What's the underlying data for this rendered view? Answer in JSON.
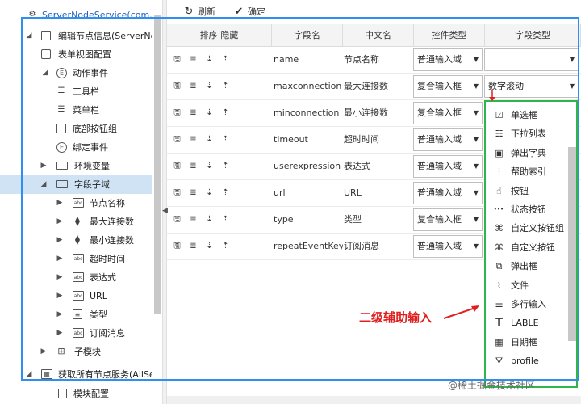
{
  "tree": {
    "items": [
      {
        "label": "ServerNodeService(com.ds.s",
        "icon": "gear-icon"
      },
      {
        "label": "编辑节点信息(ServerNod",
        "icon": "window-icon"
      },
      {
        "label": "表单视图配置",
        "icon": "form-icon"
      },
      {
        "label": "动作事件",
        "icon": "event-icon"
      },
      {
        "label": "工具栏",
        "icon": "toolbar-icon"
      },
      {
        "label": "菜单栏",
        "icon": "menu-icon"
      },
      {
        "label": "底部按钮组",
        "icon": "bottom-bar-icon"
      },
      {
        "label": "绑定事件",
        "icon": "event-icon"
      },
      {
        "label": "环境变量",
        "icon": "env-icon"
      },
      {
        "label": "字段子域",
        "icon": "field-icon"
      },
      {
        "label": "节点名称",
        "icon": "text-field-icon"
      },
      {
        "label": "最大连接数",
        "icon": "spinner-icon"
      },
      {
        "label": "最小连接数",
        "icon": "spinner-icon"
      },
      {
        "label": "超时时间",
        "icon": "text-field-icon"
      },
      {
        "label": "表达式",
        "icon": "text-field-icon"
      },
      {
        "label": "URL",
        "icon": "text-field-icon"
      },
      {
        "label": "类型",
        "icon": "list-icon"
      },
      {
        "label": "订阅消息",
        "icon": "text-field-icon"
      },
      {
        "label": "子模块",
        "icon": "modules-icon"
      },
      {
        "label": "获取所有节点服务(AllSer",
        "icon": "table-icon"
      },
      {
        "label": "模块配置",
        "icon": "doc-icon"
      }
    ]
  },
  "toolbar": {
    "refresh": "刷新",
    "confirm": "确定"
  },
  "grid": {
    "headers": [
      "排序|隐藏",
      "字段名",
      "中文名",
      "控件类型",
      "字段类型"
    ],
    "rows": [
      {
        "field": "name",
        "cn": "节点名称",
        "ctrl": "普通输入域",
        "ftype": ""
      },
      {
        "field": "maxconnection",
        "cn": "最大连接数",
        "ctrl": "复合输入框",
        "ftype": "数字滚动"
      },
      {
        "field": "minconnection",
        "cn": "最小连接数",
        "ctrl": "复合输入框",
        "ftype": ""
      },
      {
        "field": "timeout",
        "cn": "超时时间",
        "ctrl": "普通输入域",
        "ftype": ""
      },
      {
        "field": "userexpression",
        "cn": "表达式",
        "ctrl": "普通输入域",
        "ftype": ""
      },
      {
        "field": "url",
        "cn": "URL",
        "ctrl": "普通输入域",
        "ftype": ""
      },
      {
        "field": "type",
        "cn": "类型",
        "ctrl": "复合输入框",
        "ftype": ""
      },
      {
        "field": "repeatEventKey",
        "cn": "订阅消息",
        "ctrl": "普通输入域",
        "ftype": ""
      }
    ]
  },
  "dropdown": {
    "options": [
      {
        "label": "单选框",
        "icon": "checkbox-icon"
      },
      {
        "label": "下拉列表",
        "icon": "list-icon"
      },
      {
        "label": "弹出字典",
        "icon": "popup-dict-icon"
      },
      {
        "label": "帮助索引",
        "icon": "help-index-icon"
      },
      {
        "label": "按钮",
        "icon": "button-icon"
      },
      {
        "label": "状态按钮",
        "icon": "dots-icon"
      },
      {
        "label": "自定义按钮组",
        "icon": "command-icon"
      },
      {
        "label": "自定义按钮",
        "icon": "command-icon"
      },
      {
        "label": "弹出框",
        "icon": "external-icon"
      },
      {
        "label": "文件",
        "icon": "paperclip-icon"
      },
      {
        "label": "多行输入",
        "icon": "multiline-icon"
      },
      {
        "label": "LABLE",
        "icon": "text-t-icon"
      },
      {
        "label": "日期框",
        "icon": "calendar-icon"
      },
      {
        "label": "profile",
        "icon": "filter-icon"
      }
    ]
  },
  "annotation": "二级辅助输入",
  "watermark": "@稀土掘金技术社区",
  "colors": {
    "frame_blue": "#2e8ff0",
    "panel_green": "#2fb54a",
    "annotation_red": "#e02020",
    "selected_row": "#cfe3f5"
  }
}
